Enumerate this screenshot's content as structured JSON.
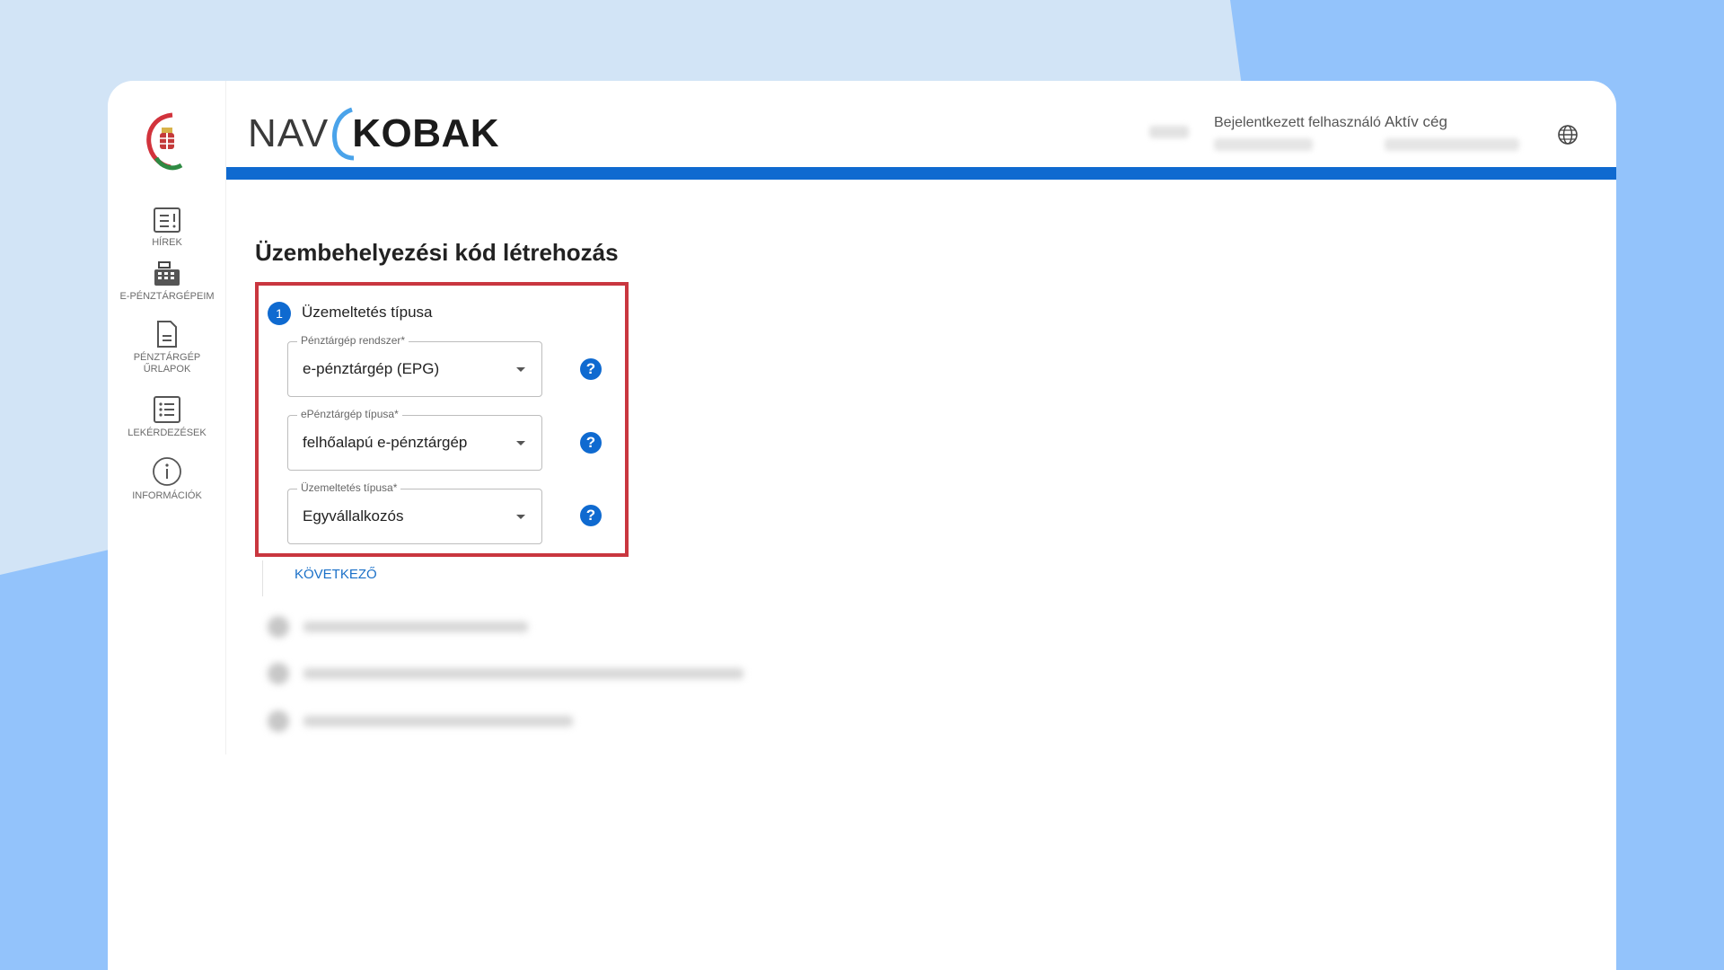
{
  "header": {
    "brand_prefix": "NAV",
    "brand_name": "KOBAK",
    "user_label": "Bejelentkezett felhasználó",
    "company_label": "Aktív cég"
  },
  "sidebar": {
    "items": [
      {
        "label": "HÍREK",
        "icon": "news-icon"
      },
      {
        "label": "E-PÉNZTÁRGÉPEIM",
        "icon": "cash-register-icon"
      },
      {
        "label": "PÉNZTÁRGÉP ŰRLAPOK",
        "icon": "document-icon"
      },
      {
        "label": "LEKÉRDEZÉSEK",
        "icon": "list-icon"
      },
      {
        "label": "INFORMÁCIÓK",
        "icon": "info-icon"
      }
    ]
  },
  "main": {
    "title": "Üzembehelyezési kód létrehozás",
    "step": {
      "number": "1",
      "label": "Üzemeltetés típusa"
    },
    "fields": [
      {
        "label": "Pénztárgép rendszer*",
        "value": "e-pénztárgép (EPG)"
      },
      {
        "label": "ePénztárgép típusa*",
        "value": "felhőalapú e-pénztárgép"
      },
      {
        "label": "Üzemeltetés típusa*",
        "value": "Egyvállalkozós"
      }
    ],
    "help_glyph": "?",
    "next_label": "KÖVETKEZŐ"
  },
  "colors": {
    "accent": "#0f6ad0",
    "highlight": "#c9363f",
    "background_light": "#d2e4f6",
    "background_blue": "#93c3fb"
  }
}
